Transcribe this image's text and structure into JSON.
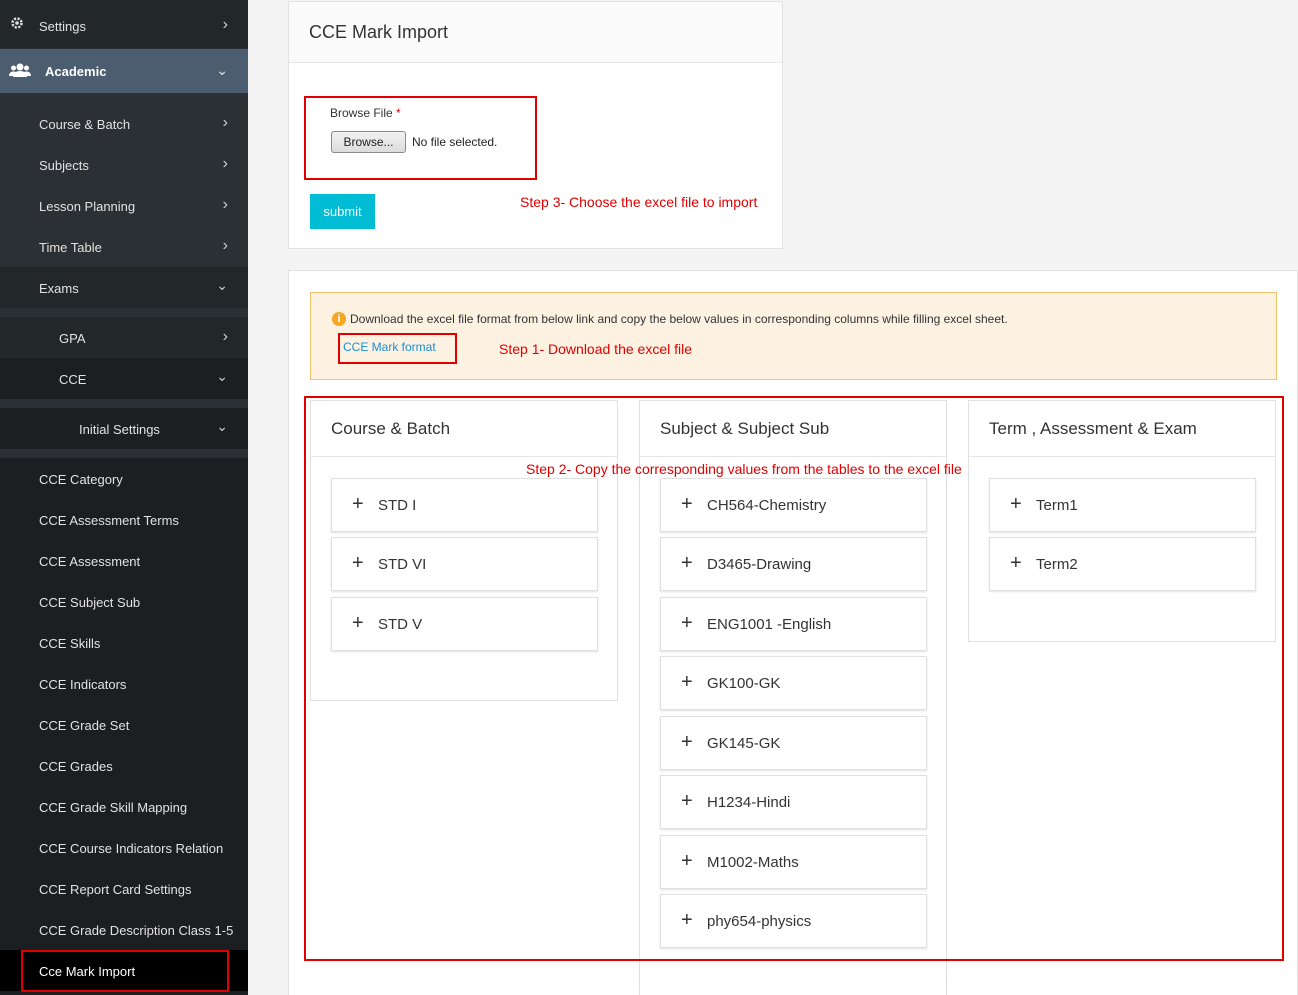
{
  "sidebar": {
    "items": [
      {
        "label": "Settings",
        "chevron": "›",
        "icon": "gear-icon"
      },
      {
        "label": "Academic",
        "chevron": "⌄",
        "icon": "users-icon"
      },
      {
        "label": "Course & Batch",
        "chevron": "›"
      },
      {
        "label": "Subjects",
        "chevron": "›"
      },
      {
        "label": "Lesson Planning",
        "chevron": "›"
      },
      {
        "label": "Time Table",
        "chevron": "›"
      },
      {
        "label": "Exams",
        "chevron": "⌄"
      },
      {
        "label": "GPA",
        "chevron": "›"
      },
      {
        "label": "CCE",
        "chevron": "⌄"
      },
      {
        "label": "Initial Settings",
        "chevron": "⌄"
      },
      {
        "label": "CCE Category"
      },
      {
        "label": "CCE Assessment Terms"
      },
      {
        "label": "CCE Assessment"
      },
      {
        "label": "CCE Subject Sub"
      },
      {
        "label": "CCE Skills"
      },
      {
        "label": "CCE Indicators"
      },
      {
        "label": "CCE Grade Set"
      },
      {
        "label": "CCE Grades"
      },
      {
        "label": "CCE Grade Skill Mapping"
      },
      {
        "label": "CCE Course Indicators Relation"
      },
      {
        "label": "CCE Report Card Settings"
      },
      {
        "label": "CCE Grade Description Class 1-5"
      },
      {
        "label": "Cce Mark Import"
      }
    ]
  },
  "import_panel": {
    "title": "CCE Mark Import",
    "field_label": "Browse File",
    "required_mark": "*",
    "browse_label": "Browse...",
    "file_status": "No file selected.",
    "submit_label": "submit",
    "step3": "Step 3- Choose the excel file to import"
  },
  "info": {
    "icon_glyph": "i",
    "message": "Download the excel file format from below link and copy the below values in corresponding columns while filling excel sheet.",
    "link_label": "CCE Mark format",
    "step1": "Step 1- Download the excel file",
    "step2": "Step 2- Copy the corresponding values from the tables to the excel file"
  },
  "columns": [
    {
      "title": "Course & Batch",
      "items": [
        "STD I",
        "STD VI",
        "STD V"
      ]
    },
    {
      "title": "Subject & Subject Sub",
      "items": [
        "CH564-Chemistry",
        "D3465-Drawing",
        "ENG1001 -English",
        "GK100-GK",
        "GK145-GK",
        "H1234-Hindi",
        "M1002-Maths",
        "phy654-physics"
      ]
    },
    {
      "title": "Term , Assessment & Exam",
      "items": [
        "Term1",
        "Term2"
      ]
    }
  ],
  "plus_glyph": "+",
  "colors": {
    "accent": "#00bcd4",
    "highlight": "#e00000",
    "sidebar": "#2b3034",
    "academic": "#4b5d6e",
    "warning_bg": "#fdf2e2"
  }
}
